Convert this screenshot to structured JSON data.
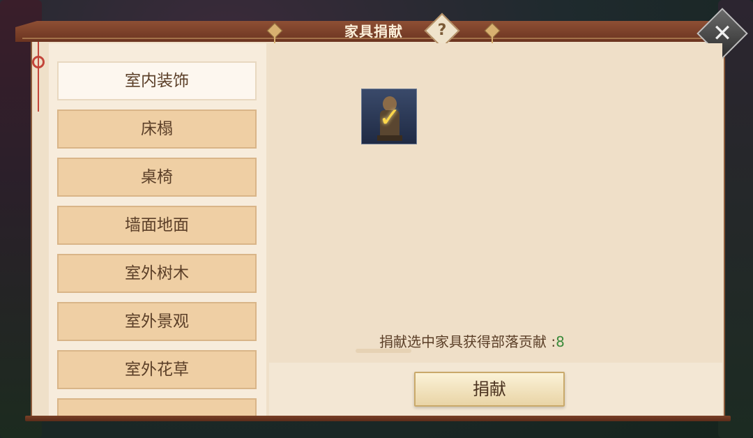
{
  "dialog": {
    "title": "家具捐献",
    "help_icon": "?",
    "close_icon": "✕"
  },
  "sidebar": {
    "items": [
      {
        "label": "室内装饰",
        "active": true
      },
      {
        "label": "床榻",
        "active": false
      },
      {
        "label": "桌椅",
        "active": false
      },
      {
        "label": "墙面地面",
        "active": false
      },
      {
        "label": "室外树木",
        "active": false
      },
      {
        "label": "室外景观",
        "active": false
      },
      {
        "label": "室外花草",
        "active": false
      },
      {
        "label": "",
        "active": false
      }
    ]
  },
  "content": {
    "selected_item_icon": "statue-icon",
    "info_text": "捐献选中家具获得部落贡献 :",
    "info_value": "8"
  },
  "footer": {
    "donate_label": "捐献"
  }
}
